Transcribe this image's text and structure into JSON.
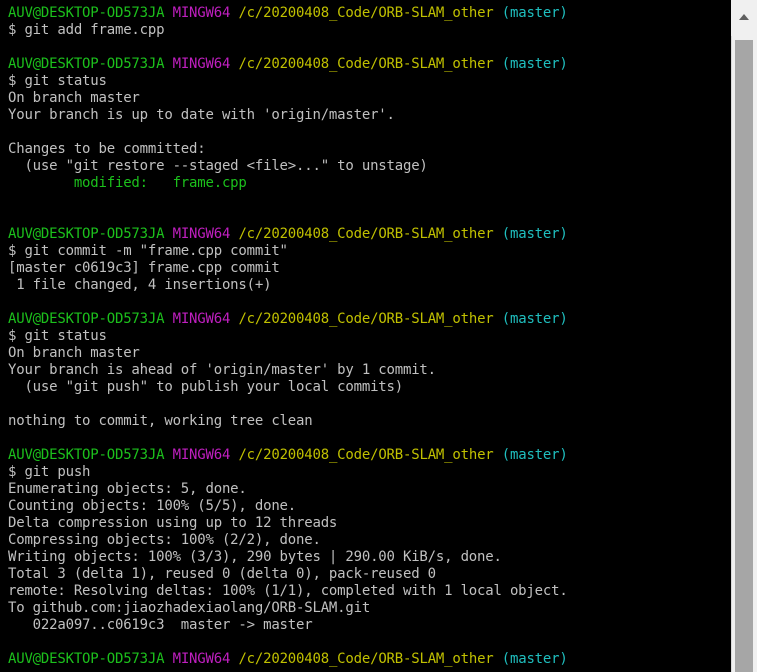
{
  "prompt": {
    "user_host": "AUV@DESKTOP-OD573JA",
    "system": "MINGW64",
    "path": "/c/20200408_Code/ORB-SLAM_other",
    "branch": "(master)"
  },
  "commands": {
    "add": "$ git add frame.cpp",
    "status1": "$ git status",
    "commit": "$ git commit -m \"frame.cpp commit\"",
    "status2": "$ git status",
    "push": "$ git push"
  },
  "status1_output": {
    "on_branch": "On branch master",
    "up_to_date": "Your branch is up to date with 'origin/master'.",
    "changes_header": "Changes to be committed:",
    "hint": "  (use \"git restore --staged <file>...\" to unstage)",
    "modified": "        modified:   frame.cpp"
  },
  "commit_output": {
    "summary": "[master c0619c3] frame.cpp commit",
    "stats": " 1 file changed, 4 insertions(+)"
  },
  "status2_output": {
    "on_branch": "On branch master",
    "ahead": "Your branch is ahead of 'origin/master' by 1 commit.",
    "hint": "  (use \"git push\" to publish your local commits)",
    "clean": "nothing to commit, working tree clean"
  },
  "push_output": {
    "enumerating": "Enumerating objects: 5, done.",
    "counting": "Counting objects: 100% (5/5), done.",
    "delta": "Delta compression using up to 12 threads",
    "compressing": "Compressing objects: 100% (2/2), done.",
    "writing": "Writing objects: 100% (3/3), 290 bytes | 290.00 KiB/s, done.",
    "total": "Total 3 (delta 1), reused 0 (delta 0), pack-reused 0",
    "remote": "remote: Resolving deltas: 100% (1/1), completed with 1 local object.",
    "to": "To github.com:jiaozhadexiaolang/ORB-SLAM.git",
    "ref_update": "   022a097..c0619c3  master -> master"
  },
  "colors": {
    "background": "#000000",
    "text": "#c0c0c0",
    "user_host": "#1cc01c",
    "system": "#bf1fbf",
    "path": "#c0c000",
    "branch": "#1fbfbf",
    "modified": "#1cc01c"
  }
}
